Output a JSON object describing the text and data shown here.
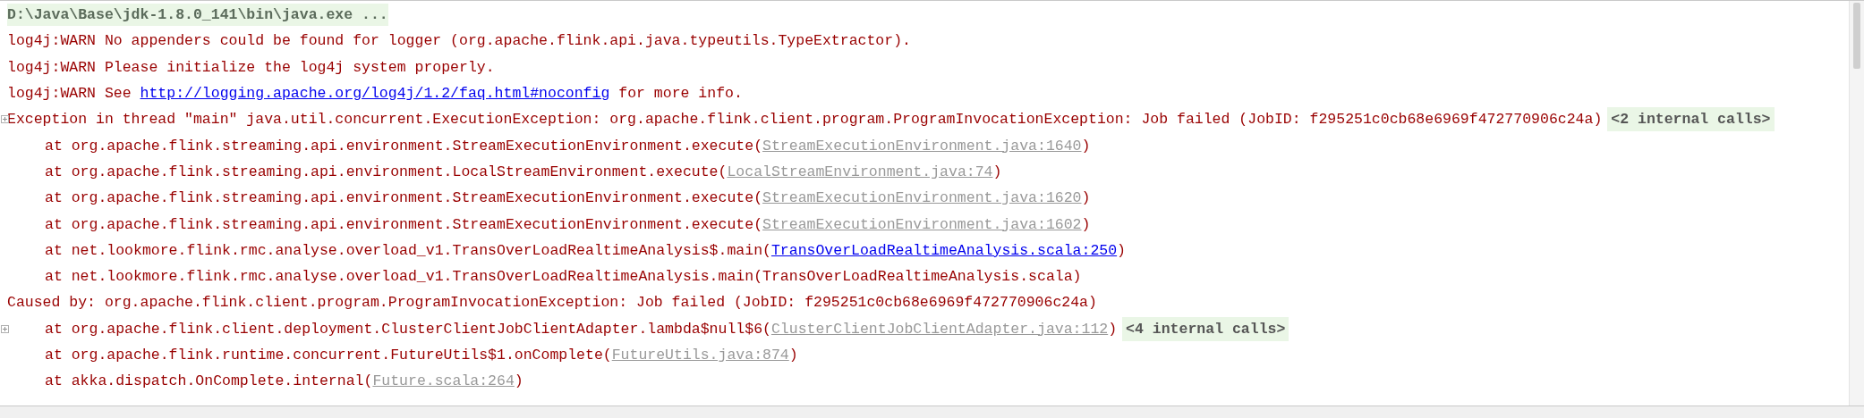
{
  "console": {
    "lines": [
      {
        "kind": "command",
        "indented": false,
        "foldable": false,
        "parts": [
          {
            "kind": "text",
            "text": "D:\\Java\\Base\\jdk-1.8.0_141\\bin\\java.exe ..."
          }
        ]
      },
      {
        "kind": "log",
        "indented": false,
        "foldable": false,
        "parts": [
          {
            "kind": "text",
            "text": "log4j:WARN No appenders could be found for logger (org.apache.flink.api.java.typeutils.TypeExtractor)."
          }
        ]
      },
      {
        "kind": "log",
        "indented": false,
        "foldable": false,
        "parts": [
          {
            "kind": "text",
            "text": "log4j:WARN Please initialize the log4j system properly."
          }
        ]
      },
      {
        "kind": "log",
        "indented": false,
        "foldable": false,
        "parts": [
          {
            "kind": "text",
            "text": "log4j:WARN See "
          },
          {
            "kind": "url",
            "text": "http://logging.apache.org/log4j/1.2/faq.html#noconfig"
          },
          {
            "kind": "text",
            "text": " for more info."
          }
        ]
      },
      {
        "kind": "log",
        "indented": false,
        "foldable": true,
        "parts": [
          {
            "kind": "text",
            "text": "Exception in thread \"main\" java.util.concurrent.ExecutionException: org.apache.flink.client.program.ProgramInvocationException: Job failed (JobID: f295251c0cb68e6969f472770906c24a)"
          },
          {
            "kind": "folded",
            "text": "<2 internal calls>"
          }
        ]
      },
      {
        "kind": "log",
        "indented": true,
        "foldable": false,
        "parts": [
          {
            "kind": "text",
            "text": "at org.apache.flink.streaming.api.environment.StreamExecutionEnvironment.execute("
          },
          {
            "kind": "source",
            "text": "StreamExecutionEnvironment.java:1640"
          },
          {
            "kind": "text",
            "text": ")"
          }
        ]
      },
      {
        "kind": "log",
        "indented": true,
        "foldable": false,
        "parts": [
          {
            "kind": "text",
            "text": "at org.apache.flink.streaming.api.environment.LocalStreamEnvironment.execute("
          },
          {
            "kind": "source",
            "text": "LocalStreamEnvironment.java:74"
          },
          {
            "kind": "text",
            "text": ")"
          }
        ]
      },
      {
        "kind": "log",
        "indented": true,
        "foldable": false,
        "parts": [
          {
            "kind": "text",
            "text": "at org.apache.flink.streaming.api.environment.StreamExecutionEnvironment.execute("
          },
          {
            "kind": "source",
            "text": "StreamExecutionEnvironment.java:1620"
          },
          {
            "kind": "text",
            "text": ")"
          }
        ]
      },
      {
        "kind": "log",
        "indented": true,
        "foldable": false,
        "parts": [
          {
            "kind": "text",
            "text": "at org.apache.flink.streaming.api.environment.StreamExecutionEnvironment.execute("
          },
          {
            "kind": "source",
            "text": "StreamExecutionEnvironment.java:1602"
          },
          {
            "kind": "text",
            "text": ")"
          }
        ]
      },
      {
        "kind": "log",
        "indented": true,
        "foldable": false,
        "parts": [
          {
            "kind": "text",
            "text": "at net.lookmore.flink.rmc.analyse.overload_v1.TransOverLoadRealtimeAnalysis$.main("
          },
          {
            "kind": "url",
            "text": "TransOverLoadRealtimeAnalysis.scala:250"
          },
          {
            "kind": "text",
            "text": ")"
          }
        ]
      },
      {
        "kind": "log",
        "indented": true,
        "foldable": false,
        "parts": [
          {
            "kind": "text",
            "text": "at net.lookmore.flink.rmc.analyse.overload_v1.TransOverLoadRealtimeAnalysis.main(TransOverLoadRealtimeAnalysis.scala)"
          }
        ]
      },
      {
        "kind": "log",
        "indented": false,
        "foldable": false,
        "parts": [
          {
            "kind": "text",
            "text": "Caused by: org.apache.flink.client.program.ProgramInvocationException: Job failed (JobID: f295251c0cb68e6969f472770906c24a)"
          }
        ]
      },
      {
        "kind": "log",
        "indented": true,
        "foldable": true,
        "parts": [
          {
            "kind": "text",
            "text": "at org.apache.flink.client.deployment.ClusterClientJobClientAdapter.lambda$null$6("
          },
          {
            "kind": "source",
            "text": "ClusterClientJobClientAdapter.java:112"
          },
          {
            "kind": "text",
            "text": ")"
          },
          {
            "kind": "folded",
            "text": "<4 internal calls>"
          }
        ]
      },
      {
        "kind": "log",
        "indented": true,
        "foldable": false,
        "parts": [
          {
            "kind": "text",
            "text": "at org.apache.flink.runtime.concurrent.FutureUtils$1.onComplete("
          },
          {
            "kind": "source",
            "text": "FutureUtils.java:874"
          },
          {
            "kind": "text",
            "text": ")"
          }
        ]
      },
      {
        "kind": "log",
        "indented": true,
        "foldable": false,
        "parts": [
          {
            "kind": "text",
            "text": "at akka.dispatch.OnComplete.internal("
          },
          {
            "kind": "source",
            "text": "Future.scala:264"
          },
          {
            "kind": "text",
            "text": ")"
          }
        ]
      }
    ]
  }
}
